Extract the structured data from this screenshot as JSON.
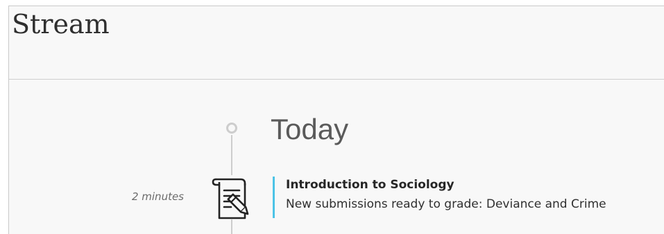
{
  "page": {
    "title": "Stream"
  },
  "stream": {
    "section_heading": "Today",
    "items": [
      {
        "time": "2 minutes",
        "icon": "assignment-icon",
        "course": "Introduction to Sociology",
        "message": "New submissions ready to grade: Deviance and Crime"
      }
    ]
  },
  "colors": {
    "accent": "#4cc3e6",
    "background": "#f8f8f8",
    "divider": "#cfcfcf"
  }
}
